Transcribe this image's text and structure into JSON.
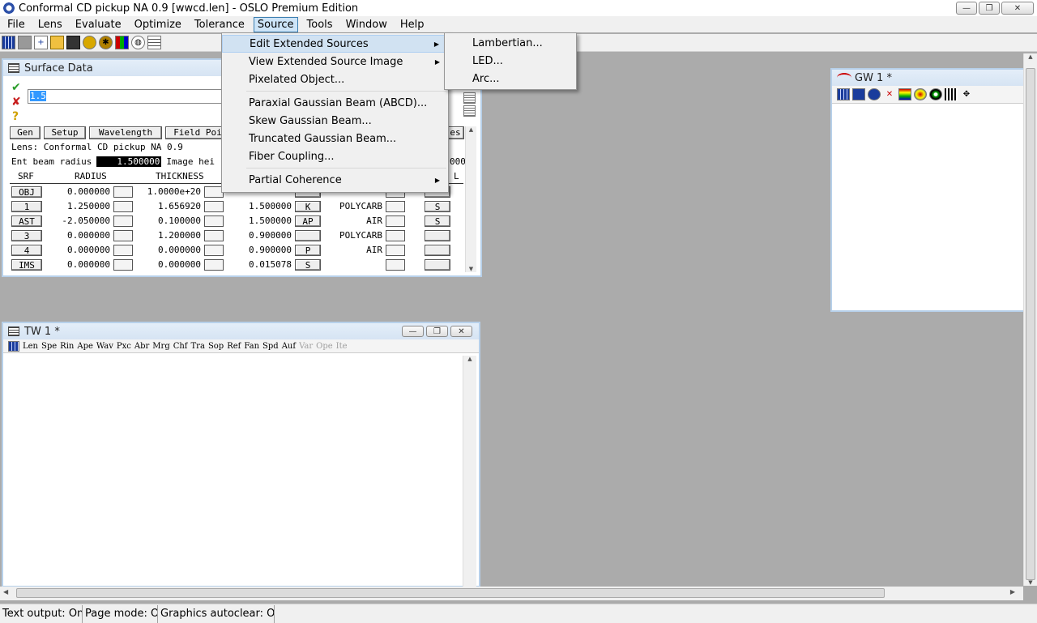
{
  "window": {
    "title": "Conformal CD pickup NA 0.9 [wwcd.len] - OSLO Premium Edition",
    "min": "—",
    "max": "❐",
    "close": "✕"
  },
  "menubar": [
    "File",
    "Lens",
    "Evaluate",
    "Optimize",
    "Tolerance",
    "Source",
    "Tools",
    "Window",
    "Help"
  ],
  "toolbar": [
    "grid",
    "blank",
    "new",
    "open",
    "save",
    "lens",
    "gear",
    "colors",
    "globe",
    "table"
  ],
  "surface_data": {
    "title": "Surface Data",
    "edit_value": "1.5",
    "accept_icon": "✔",
    "cancel_icon": "✘",
    "help_icon": "?",
    "tabs": [
      "Gen",
      "Setup",
      "Wavelength",
      "Field Poi",
      "es"
    ],
    "lens_label": "Lens: Conformal CD pickup NA 0.9",
    "ent_beam_label": "Ent beam radius",
    "ent_beam_value": "1.500000",
    "image_label": "Image hei",
    "trailing_value": "000",
    "headers": [
      "SRF",
      "RADIUS",
      "THICKNESS",
      "L"
    ],
    "rows": [
      {
        "srf": "OBJ",
        "radius": "0.000000",
        "thickness": "1.0000e+20",
        "ap": "",
        "apbtn": "",
        "glass": "",
        "s": ""
      },
      {
        "srf": "1",
        "radius": "1.250000",
        "thickness": "1.656920",
        "ap": "1.500000",
        "apbtn": "K",
        "glass": "POLYCARB",
        "s": "S"
      },
      {
        "srf": "AST",
        "radius": "-2.050000",
        "thickness": "0.100000",
        "ap": "1.500000",
        "apbtn": "AP",
        "glass": "AIR",
        "s": "S"
      },
      {
        "srf": "3",
        "radius": "0.000000",
        "thickness": "1.200000",
        "ap": "0.900000",
        "apbtn": "",
        "glass": "POLYCARB",
        "s": ""
      },
      {
        "srf": "4",
        "radius": "0.000000",
        "thickness": "0.000000",
        "ap": "0.900000",
        "apbtn": "P",
        "glass": "AIR",
        "s": ""
      },
      {
        "srf": "IMS",
        "radius": "0.000000",
        "thickness": "0.000000",
        "ap": "0.015078",
        "apbtn": "S",
        "glass": "",
        "s": ""
      }
    ]
  },
  "source_menu": {
    "items": [
      {
        "label": "Edit Extended Sources",
        "arrow": "▶"
      },
      {
        "label": "View Extended Source Image",
        "arrow": "▶"
      },
      {
        "label": "Pixelated Object..."
      },
      {
        "label": "Paraxial Gaussian Beam (ABCD)..."
      },
      {
        "label": "Skew Gaussian Beam..."
      },
      {
        "label": "Truncated Gaussian Beam..."
      },
      {
        "label": "Fiber Coupling..."
      },
      {
        "label": "Partial Coherence",
        "arrow": "▶"
      }
    ]
  },
  "submenu": [
    "Lambertian...",
    "LED...",
    "Arc..."
  ],
  "gw": {
    "title": "GW 1 *"
  },
  "tw": {
    "title": "TW 1 *",
    "buttons_active": [
      "Len",
      "Spe",
      "Rin",
      "Ape",
      "Wav",
      "Pxc",
      "Abr",
      "Mrg",
      "Chf",
      "Tra",
      "Sop",
      "Ref",
      "Fan",
      "Spd",
      "Auf"
    ],
    "buttons_inactive": [
      "Var",
      "Ope",
      "Ite"
    ]
  },
  "statusbar": [
    "Text output: On",
    "Page mode: Of",
    "Graphics autoclear: On"
  ]
}
